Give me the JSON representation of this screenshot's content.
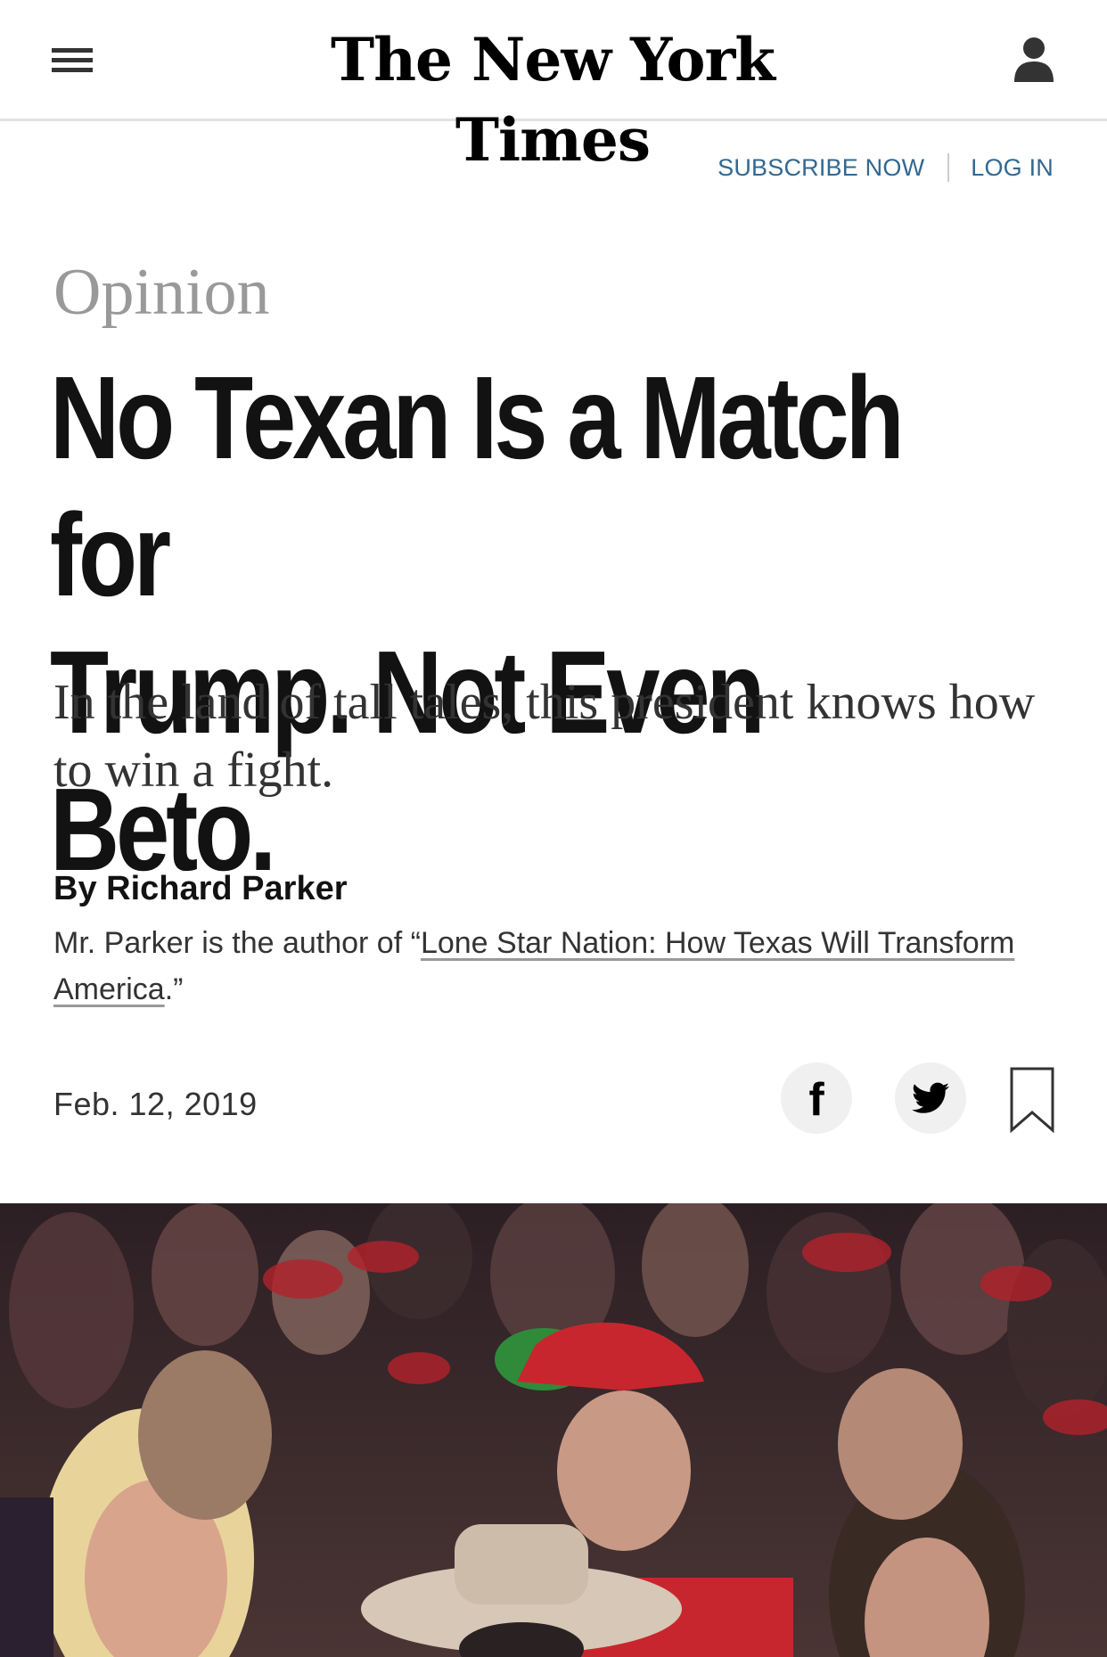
{
  "masthead": {
    "logo_text": "The New York Times",
    "menu_icon": "hamburger-menu-icon",
    "user_icon": "user-account-icon"
  },
  "account": {
    "subscribe_label": "SUBSCRIBE NOW",
    "login_label": "LOG IN"
  },
  "article": {
    "kicker": "Opinion",
    "headline_line1": "No Texan Is a Match for",
    "headline_line2": "Trump. Not Even Beto.",
    "summary": "In the land of tall tales, this president knows how to win a fight.",
    "byline": "By Richard Parker",
    "bio_prefix": "Mr. Parker is the author of “",
    "bio_link": "Lone Star Nation: How Texas Will Transform America",
    "bio_suffix": ".”",
    "date": "Feb. 12, 2019"
  },
  "share": {
    "facebook_icon": "facebook-icon",
    "twitter_icon": "twitter-icon",
    "bookmark_icon": "bookmark-icon"
  },
  "colors": {
    "link_blue": "#326891",
    "kicker_gray": "#999999",
    "text": "#121212"
  }
}
